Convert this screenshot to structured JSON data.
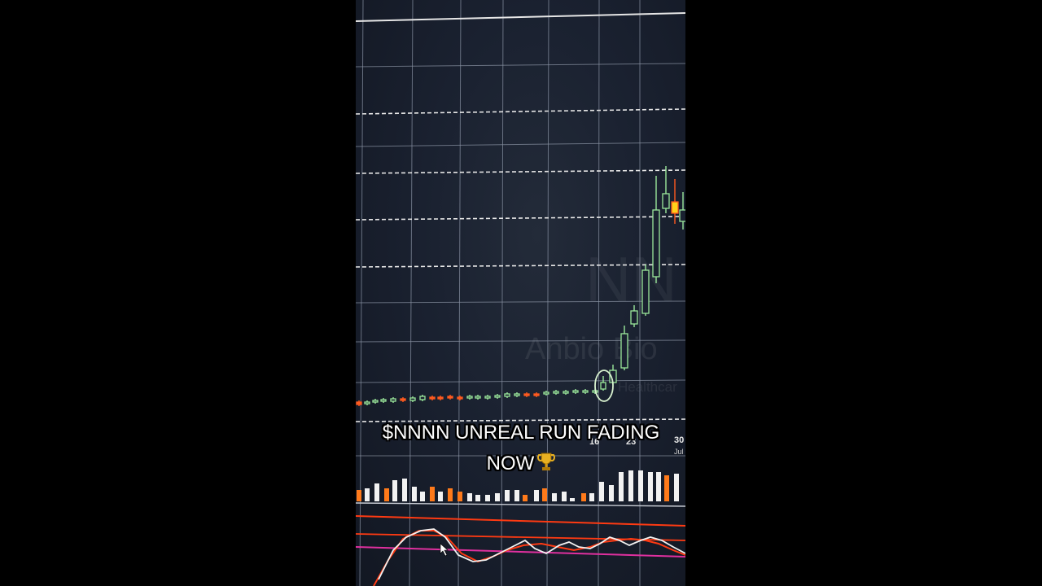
{
  "caption": {
    "line1": "$NNNN UNREAL RUN FADING",
    "line2": "NOW",
    "icon": "trophy-icon"
  },
  "chart_watermark": {
    "ticker": "NN",
    "company": "Anbio Bio",
    "sector": "Healthcar"
  },
  "x_axis": {
    "ticks": [
      "16",
      "23",
      "30"
    ],
    "sub_tick": "Jul"
  },
  "colors": {
    "background": "#000000",
    "chart_bg": "#1a2130",
    "bull_candle": "#9be89b",
    "bear_candle": "#ff5a1f",
    "volume_up": "#f2f2f2",
    "volume_down": "#ff7a1a",
    "stoch_k": "#f2f2f2",
    "stoch_d": "#ff3a12",
    "band_line": "#e0309f"
  }
}
